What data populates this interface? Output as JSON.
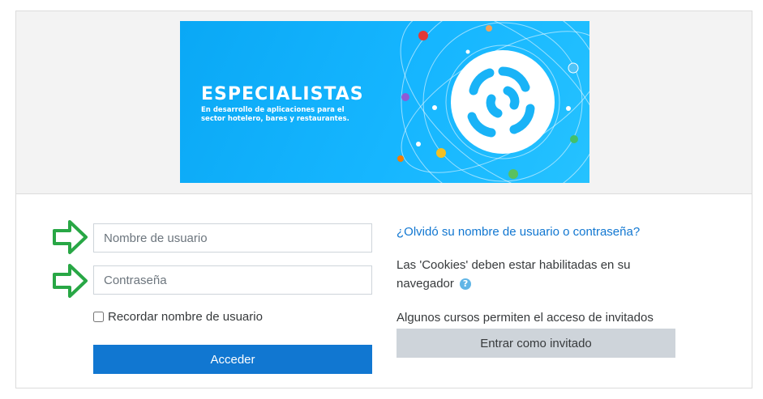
{
  "banner": {
    "title": "ESPECIALISTAS",
    "subtitle_line1": "En desarrollo de aplicaciones para el",
    "subtitle_line2": "sector hotelero, bares y restaurantes."
  },
  "login": {
    "username_placeholder": "Nombre de usuario",
    "password_placeholder": "Contraseña",
    "remember_label": "Recordar nombre de usuario",
    "remember_checked": false,
    "submit_label": "Acceder"
  },
  "side": {
    "forgot_link": "¿Olvidó su nombre de usuario o contraseña?",
    "cookies_line1": "Las 'Cookies' deben estar habilitadas en su",
    "cookies_line2": "navegador",
    "help_icon_glyph": "?",
    "guests_note": "Algunos cursos permiten el acceso de invitados",
    "guest_button": "Entrar como invitado"
  },
  "colors": {
    "primary": "#1177d1",
    "secondary_button": "#ced4da",
    "arrow_stroke": "#28a745",
    "banner_bg": "#16b6ff"
  },
  "icons": [
    "help-icon",
    "green-arrow-icon",
    "logo-swirl-icon"
  ]
}
